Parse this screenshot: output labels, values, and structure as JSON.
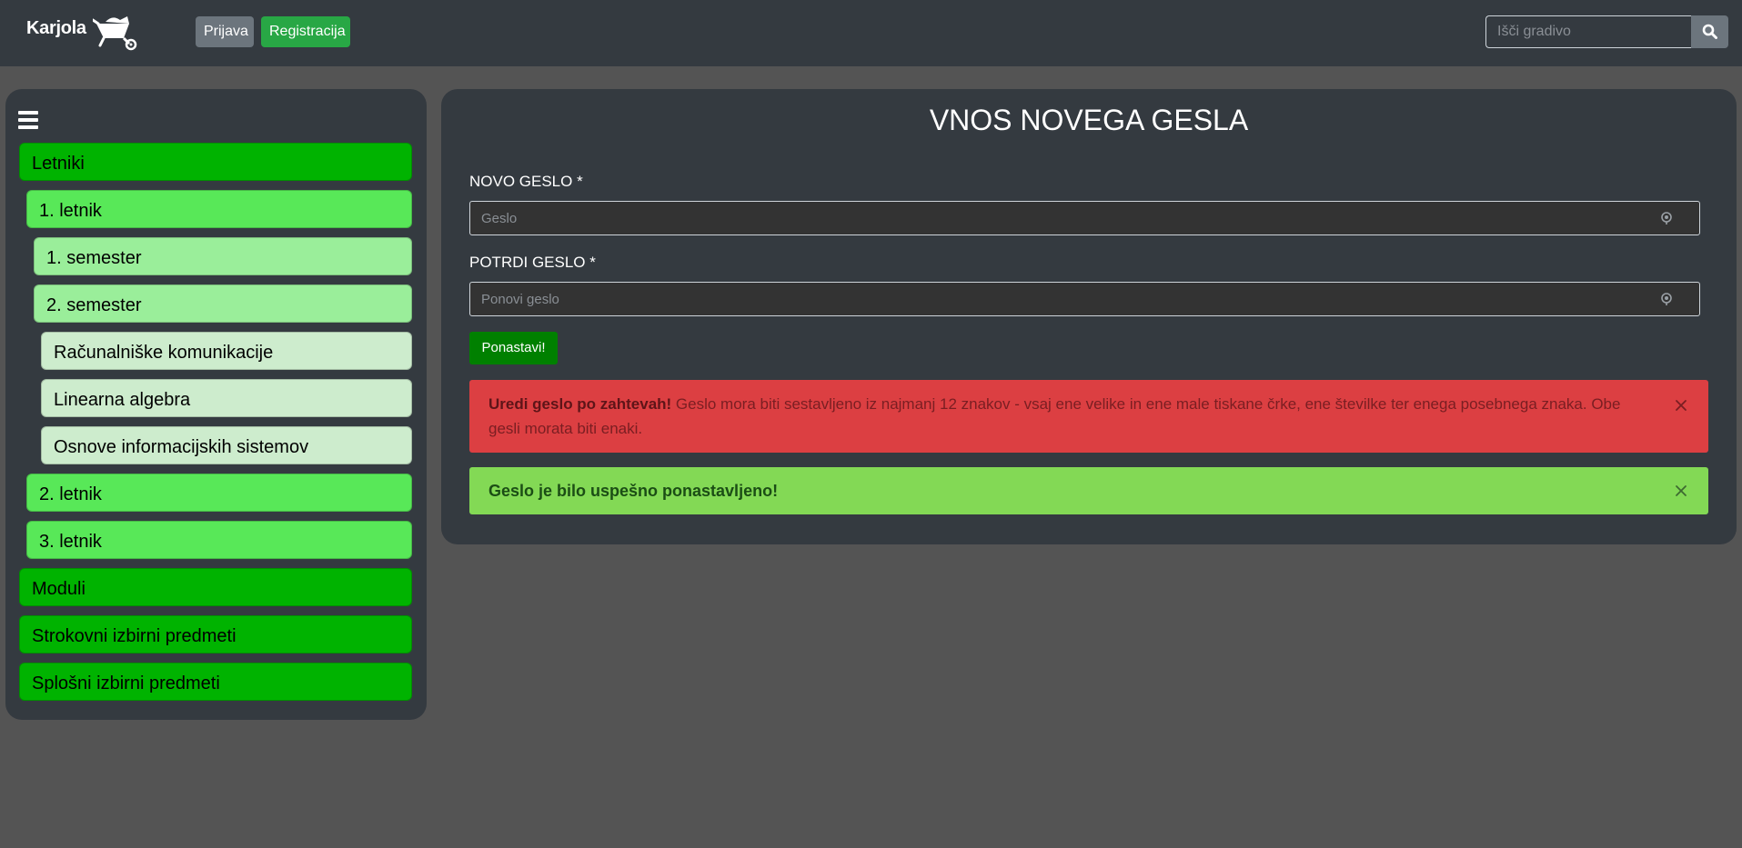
{
  "navbar": {
    "brand": "Karjola",
    "login_label": "Prijava",
    "register_label": "Registracija",
    "search_placeholder": "Išči gradivo"
  },
  "sidebar": {
    "items": [
      {
        "label": "Letniki",
        "level": 0
      },
      {
        "label": "1. letnik",
        "level": 1
      },
      {
        "label": "1. semester",
        "level": 2
      },
      {
        "label": "2. semester",
        "level": 2
      },
      {
        "label": "Računalniške komunikacije",
        "level": 3
      },
      {
        "label": "Linearna algebra",
        "level": 3
      },
      {
        "label": "Osnove informacijskih sistemov",
        "level": 3
      },
      {
        "label": "2. letnik",
        "level": 1
      },
      {
        "label": "3. letnik",
        "level": 1
      },
      {
        "label": "Moduli",
        "level": 0
      },
      {
        "label": "Strokovni izbirni predmeti",
        "level": 0
      },
      {
        "label": "Splošni izbirni predmeti",
        "level": 0
      }
    ]
  },
  "main": {
    "title": "VNOS NOVEGA GESLA",
    "new_password_label": "NOVO GESLO *",
    "new_password_placeholder": "Geslo",
    "confirm_password_label": "POTRDI GESLO *",
    "confirm_password_placeholder": "Ponovi geslo",
    "reset_button": "Ponastavi!",
    "error_alert": {
      "title": "Uredi geslo po zahtevah!",
      "text": " Geslo mora biti sestavljeno iz najmanj 12 znakov - vsaj ene velike in ene male tiskane črke, ene številke ter enega posebnega znaka. Obe gesli morata biti enaki."
    },
    "success_alert": "Geslo je bilo uspešno ponastavljeno!"
  },
  "colors": {
    "navbar_bg": "#343a40",
    "page_bg": "#545454",
    "level0": "#00b300",
    "level1": "#58e858",
    "level2": "#9aee9a",
    "level3": "#cdeccd",
    "danger": "#dc3f42",
    "success": "#83d955",
    "primary_button": "#008000"
  },
  "icons": [
    "wheelbarrow-logo-icon",
    "search-icon",
    "hamburger-menu-icon",
    "eye-icon",
    "close-icon"
  ]
}
